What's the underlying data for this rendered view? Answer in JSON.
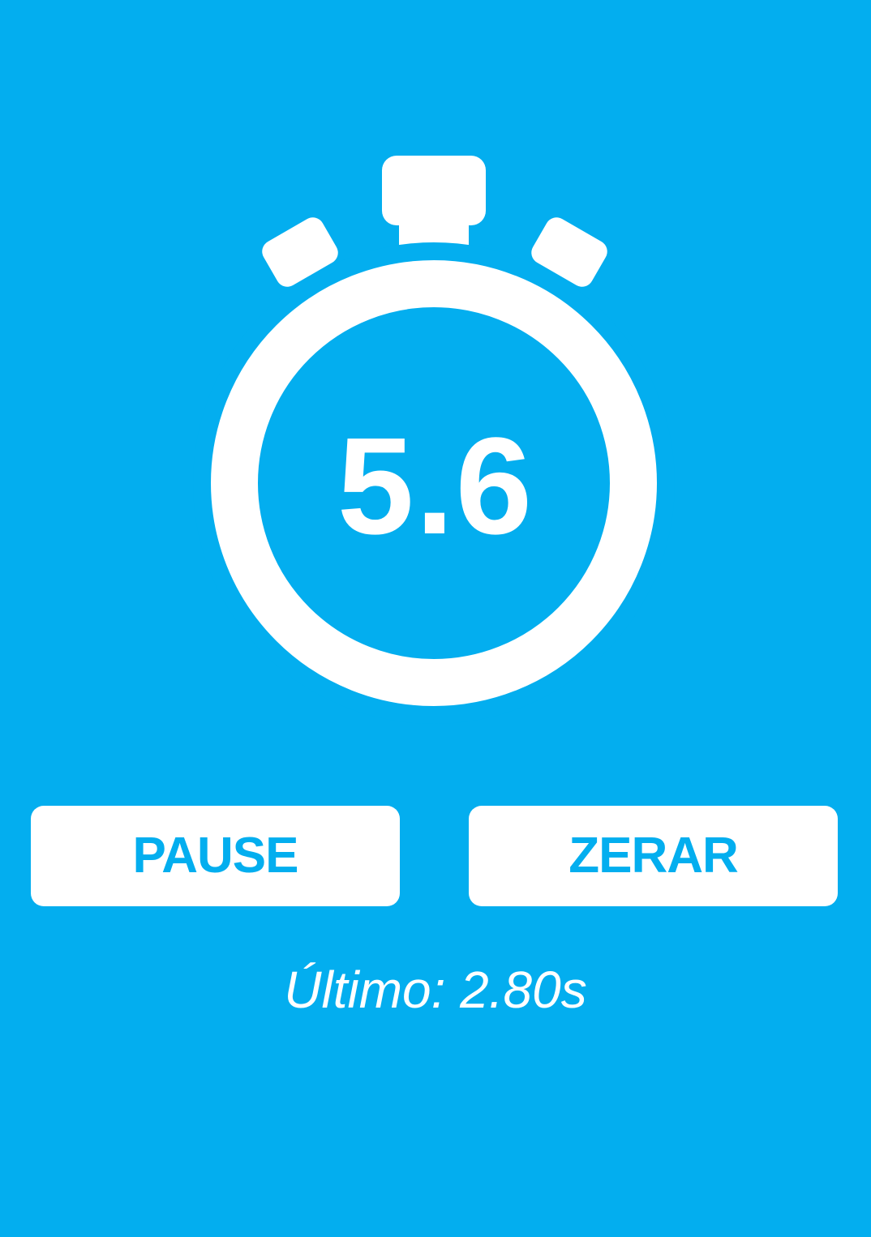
{
  "timer": {
    "elapsed": "5.6"
  },
  "buttons": {
    "pause_label": "PAUSE",
    "reset_label": "ZERAR"
  },
  "last": {
    "text": "Último: 2.80s"
  },
  "colors": {
    "background": "#03aeef",
    "foreground": "#ffffff",
    "button_text": "#03aeef"
  },
  "icons": {
    "stopwatch": "stopwatch-icon"
  }
}
